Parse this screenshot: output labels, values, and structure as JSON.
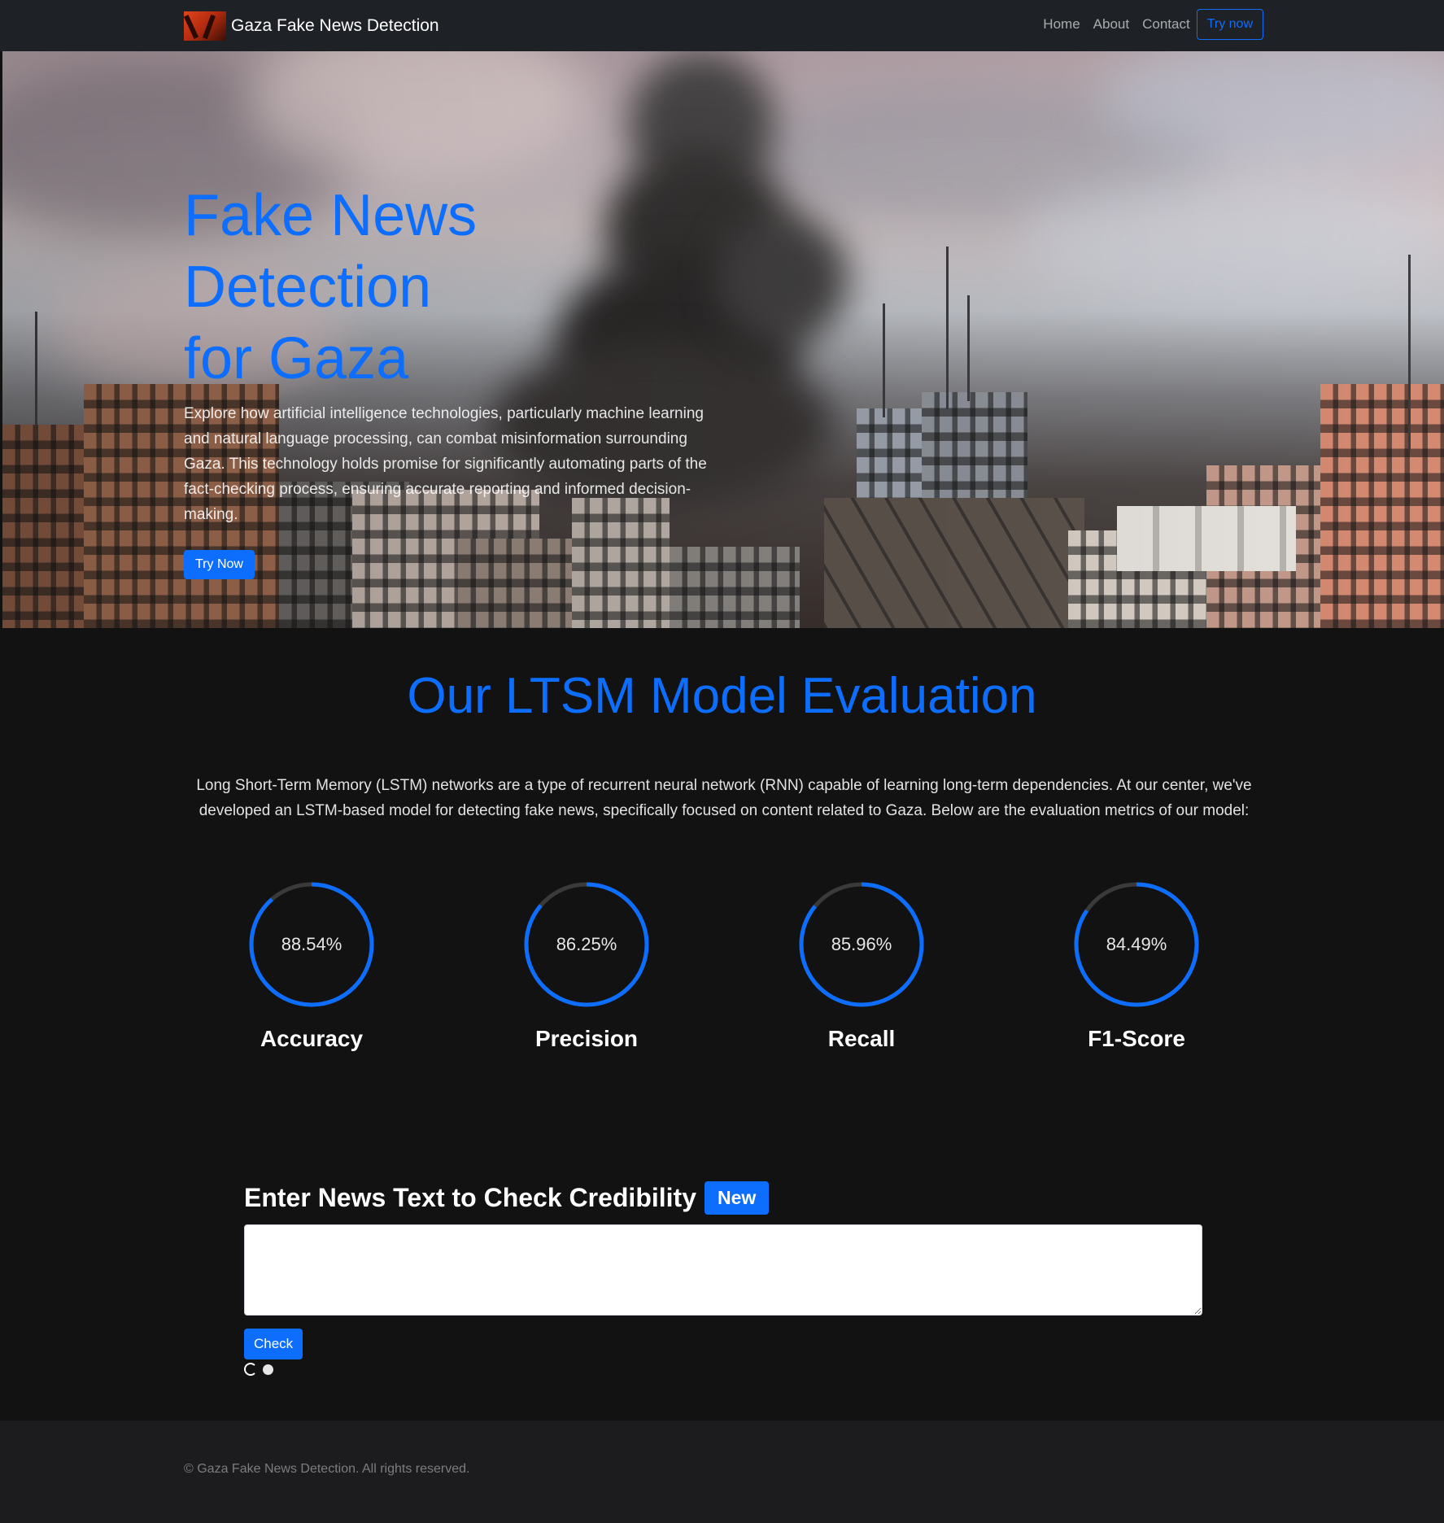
{
  "navbar": {
    "brand_title": "Gaza Fake News Detection",
    "links": [
      "Home",
      "About",
      "Contact"
    ],
    "cta_label": "Try now"
  },
  "hero": {
    "title_line1": "Fake News Detection",
    "title_line2": "for Gaza",
    "text": "Explore how artificial intelligence technologies, particularly machine learning and natural language processing, can combat misinformation surrounding Gaza. This technology holds promise for significantly automating parts of the fact-checking process, ensuring accurate reporting and informed decision-making.",
    "button_label": "Try Now"
  },
  "evaluation": {
    "title": "Our LTSM Model Evaluation",
    "description": "Long Short-Term Memory (LSTM) networks are a type of recurrent neural network (RNN) capable of learning long-term dependencies. At our center, we've developed an LSTM-based model for detecting fake news, specifically focused on content related to Gaza. Below are the evaluation metrics of our model:",
    "metrics": [
      {
        "label": "Accuracy",
        "value_text": "88.54%",
        "value": 88.54
      },
      {
        "label": "Precision",
        "value_text": "86.25%",
        "value": 86.25
      },
      {
        "label": "Recall",
        "value_text": "85.96%",
        "value": 85.96
      },
      {
        "label": "F1-Score",
        "value_text": "84.49%",
        "value": 84.49
      }
    ]
  },
  "check": {
    "title": "Enter News Text to Check Credibility",
    "badge": "New",
    "input_value": "",
    "button_label": "Check"
  },
  "footer": {
    "text": "© Gaza Fake News Detection. All rights reserved."
  },
  "colors": {
    "accent": "#0d6efd",
    "page_background": "#121212",
    "navbar_background": "#1e2126",
    "footer_background": "#1c1c1e",
    "ring_track": "#3a3a3a"
  }
}
